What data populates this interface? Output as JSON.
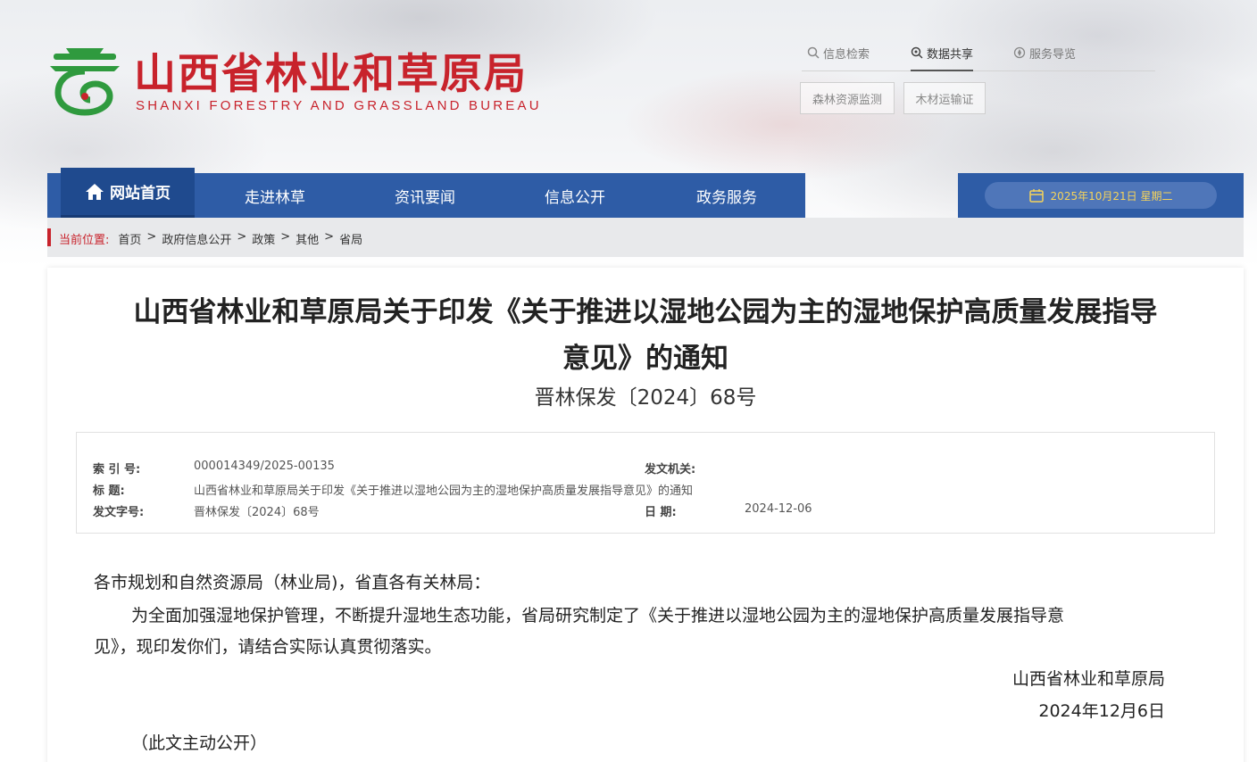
{
  "site": {
    "title": "山西省林业和草原局",
    "subtitle": "SHANXI FORESTRY AND GRASSLAND BUREAU",
    "brand_color": "#c8232c",
    "nav_color": "#2e5ca6"
  },
  "top_links": [
    {
      "label": "信息检索",
      "icon": "search-icon"
    },
    {
      "label": "数据共享",
      "icon": "data-share-icon"
    },
    {
      "label": "服务导览",
      "icon": "compass-icon"
    }
  ],
  "system_buttons": [
    {
      "label": "森林资源监测"
    },
    {
      "label": "木材运输证"
    }
  ],
  "nav": [
    {
      "label": "网站首页",
      "icon": "home-icon"
    },
    {
      "label": "走进林草"
    },
    {
      "label": "资讯要闻"
    },
    {
      "label": "信息公开"
    },
    {
      "label": "政务服务"
    }
  ],
  "date_text": "2025年10月21日 星期二",
  "breadcrumb": {
    "label": "当前位置:",
    "items": [
      "首页",
      "政府信息公开",
      "政策",
      "其他",
      "省局"
    ]
  },
  "document": {
    "title_line1": "山西省林业和草原局关于印发《关于推进以湿地公园为主的湿地保护高质量发展指导",
    "title_line2": "意见》的通知",
    "number": "晋林保发〔2024〕68号",
    "meta": {
      "index_label": "索  引 号:",
      "index_value": "000014349/2025-00135",
      "title_label": "标      题:",
      "title_value": "山西省林业和草原局关于印发《关于推进以湿地公园为主的湿地保护高质量发展指导意见》的通知",
      "doc_no_label": "发文字号:",
      "doc_no_value": "晋林保发〔2024〕68号",
      "issuer_label": "发文机关:",
      "date_label": "日      期:",
      "date_value": "2024-12-06"
    },
    "salutation": "各市规划和自然资源局（林业局)，省直各有关林局：",
    "para_line1": "为全面加强湿地保护管理，不断提升湿地生态功能，省局研究制定了《关于推进以湿地公园为主的湿地保护高质量发展指导意",
    "para_line2": "见》，现印发你们，请结合实际认真贯彻落实。",
    "signer": "山西省林业和草原局",
    "sign_date": "2024年12月6日",
    "public_note": "（此文主动公开）"
  }
}
